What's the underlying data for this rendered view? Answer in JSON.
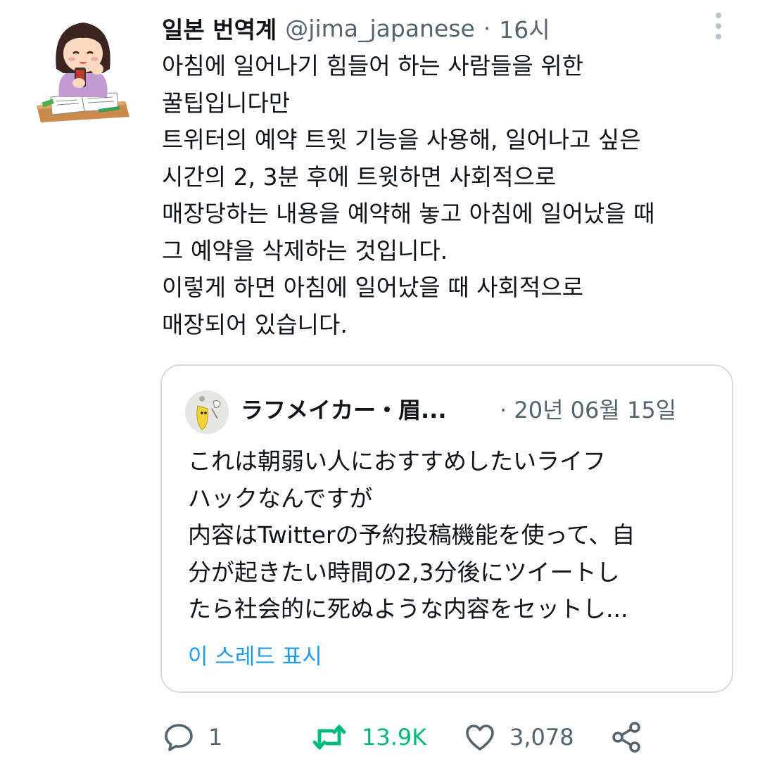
{
  "author": {
    "name": "일본 번역계",
    "handle": "@jima_japanese",
    "separator": "·",
    "time": "16시"
  },
  "tweet": {
    "lines": [
      "아침에 일어나기 힘들어 하는 사람들을 위한",
      "꿀팁입니다만",
      "트위터의 예약 트윗 기능을 사용해, 일어나고 싶은",
      "시간의 2, 3분 후에 트윗하면 사회적으로",
      "매장당하는 내용을 예약해 놓고 아침에 일어났을 때",
      "그 예약을 삭제하는 것입니다.",
      "이렇게 하면 아침에 일어났을 때 사회적으로",
      "매장되어 있습니다."
    ]
  },
  "quote": {
    "name": "ラフメイカー・眉...",
    "separator": "·",
    "date": "20년 06월 15일",
    "lines": [
      "これは朝弱い人におすすめしたいライフ",
      "ハックなんですが",
      "内容はTwitterの予約投稿機能を使って、自",
      "分が起きたい時間の2,3分後にツイートし",
      "たら社会的に死ぬような内容をセットし..."
    ],
    "show_thread": "이 스레드 표시"
  },
  "actions": {
    "reply_count": "1",
    "retweet_count": "13.9K",
    "like_count": "3,078",
    "icons": [
      "reply-icon",
      "retweet-icon",
      "like-icon",
      "share-icon"
    ]
  },
  "colors": {
    "text": "#0f1419",
    "secondary": "#536471",
    "link": "#1d9bf0",
    "retweet": "#00ba7c",
    "border": "#d4dbe0"
  }
}
